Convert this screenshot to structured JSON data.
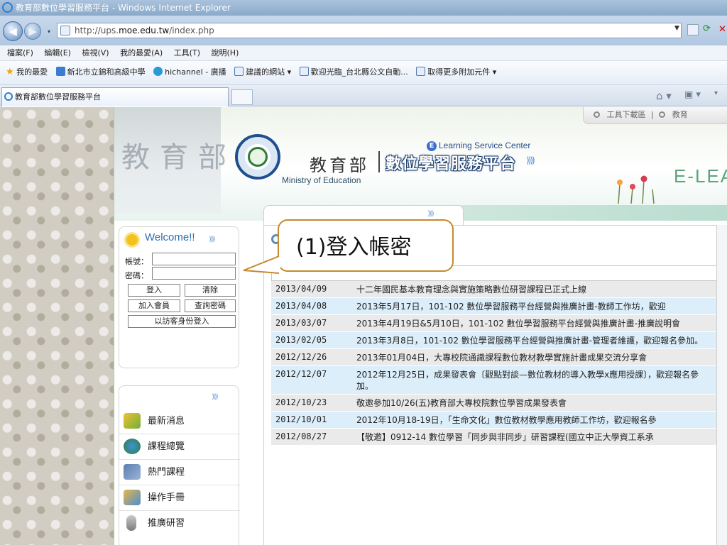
{
  "window": {
    "title": "教育部數位學習服務平台 - Windows Internet Explorer"
  },
  "address": {
    "url_prefix": "http://ups.",
    "url_host": "moe.edu.tw",
    "url_path": "/index.php"
  },
  "menu": [
    "檔案(F)",
    "編輯(E)",
    "檢視(V)",
    "我的最愛(A)",
    "工具(T)",
    "說明(H)"
  ],
  "favorites": {
    "label": "我的最愛",
    "items": [
      "新北市立錦和高級中學",
      "hichannel - 廣播",
      "建議的網站 ▾",
      "歡迎光臨_台北縣公文自動...",
      "取得更多附加元件 ▾"
    ]
  },
  "tab": {
    "label": "教育部數位學習服務平台"
  },
  "toolbar_links": {
    "tools": "工具下載區",
    "separator": "|",
    "edu": "教育"
  },
  "banner": {
    "calligraphy": "教育部",
    "moe_zh": "教育部",
    "moe_en": "Ministry of Education",
    "platform_title": "數位學習服務平台",
    "platform_arrows": "))))",
    "els_badge": "E",
    "els_text": "Learning Service Center",
    "elearn_big": "E-LEA"
  },
  "login": {
    "title": "Welcome!!",
    "arrows": "))))",
    "account_label": "帳號：",
    "password_label": "密碼：",
    "login_btn": "登入",
    "clear_btn": "清除",
    "join_btn": "加入會員",
    "query_pw_btn": "查詢密碼",
    "guest_btn": "以訪客身份登入"
  },
  "nav": {
    "arrows": "))))",
    "items": [
      {
        "label": "最新消息"
      },
      {
        "label": "課程總覽"
      },
      {
        "label": "熱門課程"
      },
      {
        "label": "操作手冊"
      },
      {
        "label": "推廣研習"
      }
    ]
  },
  "news": {
    "tab_arrows": "))))",
    "rows": [
      {
        "date": "2013/04/09",
        "title": "十二年國民基本教育理念與實施策略數位研習課程已正式上線"
      },
      {
        "date": "2013/04/08",
        "title": "2013年5月17日，101-102 數位學習服務平台經營與推廣計畫-教師工作坊，歡迎"
      },
      {
        "date": "2013/03/07",
        "title": "2013年4月19日&5月10日，101-102 數位學習服務平台經營與推廣計畫-推廣說明會"
      },
      {
        "date": "2013/02/05",
        "title": "2013年3月8日，101-102 數位學習服務平台經營與推廣計畫-管理者維護，歡迎報名參加。"
      },
      {
        "date": "2012/12/26",
        "title": "2013年01月04日，大專校院通識課程數位教材教學實施計畫成果交流分享會"
      },
      {
        "date": "2012/12/07",
        "title": "2012年12月25日，成果發表會〔觀點對談—數位教材的導入教學x應用授課〕，歡迎報名參加。"
      },
      {
        "date": "2012/10/23",
        "title": "敬邀參加10/26(五)教育部大專校院數位學習成果發表會"
      },
      {
        "date": "2012/10/01",
        "title": "2012年10月18-19日，「生命文化」數位教材教學應用教師工作坊，歡迎報名參"
      },
      {
        "date": "2012/08/27",
        "title": "【敬邀】0912-14 數位學習「同步與非同步」研習課程(國立中正大學資工系承"
      }
    ]
  },
  "callout": {
    "text": "(1)登入帳密"
  },
  "colors": {
    "callout_border": "#c48a2c",
    "row_gray": "#eaeaea",
    "row_blue": "#dceefa",
    "welcome_blue": "#2c6fb5"
  }
}
